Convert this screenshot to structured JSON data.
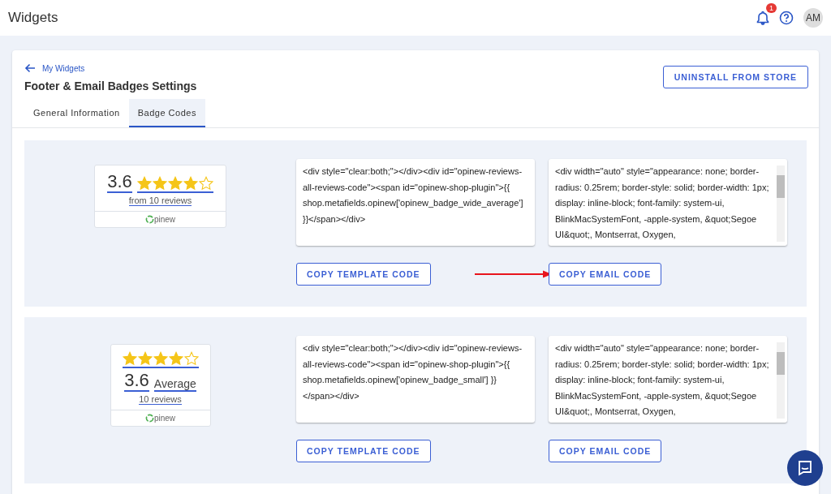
{
  "header": {
    "title": "Widgets",
    "notification_count": "1",
    "avatar": "AM"
  },
  "page": {
    "back_link": "My Widgets",
    "title": "Footer & Email Badges Settings",
    "uninstall_button": "UNINSTALL FROM STORE"
  },
  "tabs": [
    {
      "label": "General Information",
      "selected": false
    },
    {
      "label": "Badge Codes",
      "selected": true
    }
  ],
  "badges": [
    {
      "kind": "wide",
      "rating": "3.6",
      "stars": 4,
      "reviews": "from 10 reviews",
      "logo": "pinew",
      "template_code": "<div style=\"clear:both;\"></div><div id=\"opinew-reviews-all-reviews-code\"><span id=\"opinew-shop-plugin\">{{ shop.metafields.opinew['opinew_badge_wide_average'] }}</span></div>",
      "email_code": "<div width=\"auto\" style=\"appearance: none; border-radius: 0.25rem; border-style: solid; border-width: 1px; display: inline-block; font-family: system-ui, BlinkMacSystemFont, -apple-system, &quot;Segoe UI&quot;, Montserrat, Oxygen,",
      "template_button": "COPY TEMPLATE CODE",
      "email_button": "COPY EMAIL CODE",
      "arrow": true
    },
    {
      "kind": "small",
      "rating": "3.6",
      "stars": 4,
      "label": "Average",
      "reviews": "10 reviews",
      "logo": "pinew",
      "template_code": "<div style=\"clear:both;\"></div><div id=\"opinew-reviews-all-reviews-code\"><span id=\"opinew-shop-plugin\">{{ shop.metafields.opinew['opinew_badge_small'] }} </span></div>",
      "email_code": "<div width=\"auto\" style=\"appearance: none; border-radius: 0.25rem; border-style: solid; border-width: 1px; display: inline-block; font-family: system-ui, BlinkMacSystemFont, -apple-system, &quot;Segoe UI&quot;, Montserrat, Oxygen,",
      "template_button": "COPY TEMPLATE CODE",
      "email_button": "COPY EMAIL CODE",
      "arrow": false
    }
  ]
}
